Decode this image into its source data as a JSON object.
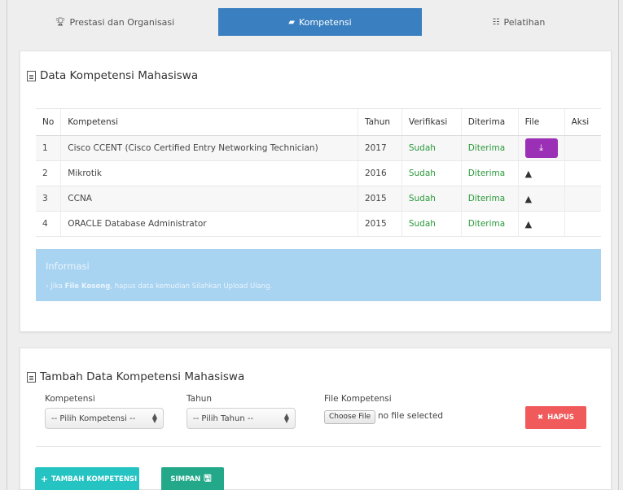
{
  "tabs": [
    {
      "label": "Prestasi dan Organisasi",
      "icon": "trophy-icon"
    },
    {
      "label": "Kompetensi",
      "icon": "book-icon",
      "active": true
    },
    {
      "label": "Pelatihan",
      "icon": "list-icon"
    }
  ],
  "data_panel": {
    "title": "Data Kompetensi Mahasiswa",
    "columns": [
      "No",
      "Kompetensi",
      "Tahun",
      "Verifikasi",
      "Diterima",
      "File",
      "Aksi"
    ],
    "rows": [
      {
        "no": "1",
        "kompetensi": "Cisco CCENT (Cisco Certified Entry Networking Technician)",
        "tahun": "2017",
        "verifikasi": "Sudah",
        "diterima": "Diterima",
        "file": "download"
      },
      {
        "no": "2",
        "kompetensi": "Mikrotik",
        "tahun": "2016",
        "verifikasi": "Sudah",
        "diterima": "Diterima",
        "file": "warning"
      },
      {
        "no": "3",
        "kompetensi": "CCNA",
        "tahun": "2015",
        "verifikasi": "Sudah",
        "diterima": "Diterima",
        "file": "warning"
      },
      {
        "no": "4",
        "kompetensi": "ORACLE Database Administrator",
        "tahun": "2015",
        "verifikasi": "Sudah",
        "diterima": "Diterima",
        "file": "warning"
      }
    ],
    "info": {
      "title": "Informasi",
      "bullet": "›",
      "prefix": "Jika",
      "bold": "File Kosong",
      "suffix": ", hapus data kemudian Silahkan Upload Ulang."
    }
  },
  "form_panel": {
    "title": "Tambah Data Kompetensi Mahasiswa",
    "kompetensi_label": "Kompetensi",
    "kompetensi_value": "-- Pilih Kompetensi --",
    "tahun_label": "Tahun",
    "tahun_value": "-- Pilih Tahun --",
    "file_label": "File Kompetensi",
    "choose_file": "Choose File",
    "no_file": "no file selected",
    "hapus": "HAPUS",
    "tambah": "TAMBAH KOMPETENSI",
    "simpan": "SIMPAN"
  },
  "colors": {
    "active_tab": "#3a7fc0",
    "success_text": "#2a9a3a",
    "download_button": "#9b2fb5",
    "info_box": "#a8d3f1",
    "hapus_button": "#f05a5a",
    "tambah_button": "#26c3c3",
    "simpan_button": "#23a98a"
  }
}
